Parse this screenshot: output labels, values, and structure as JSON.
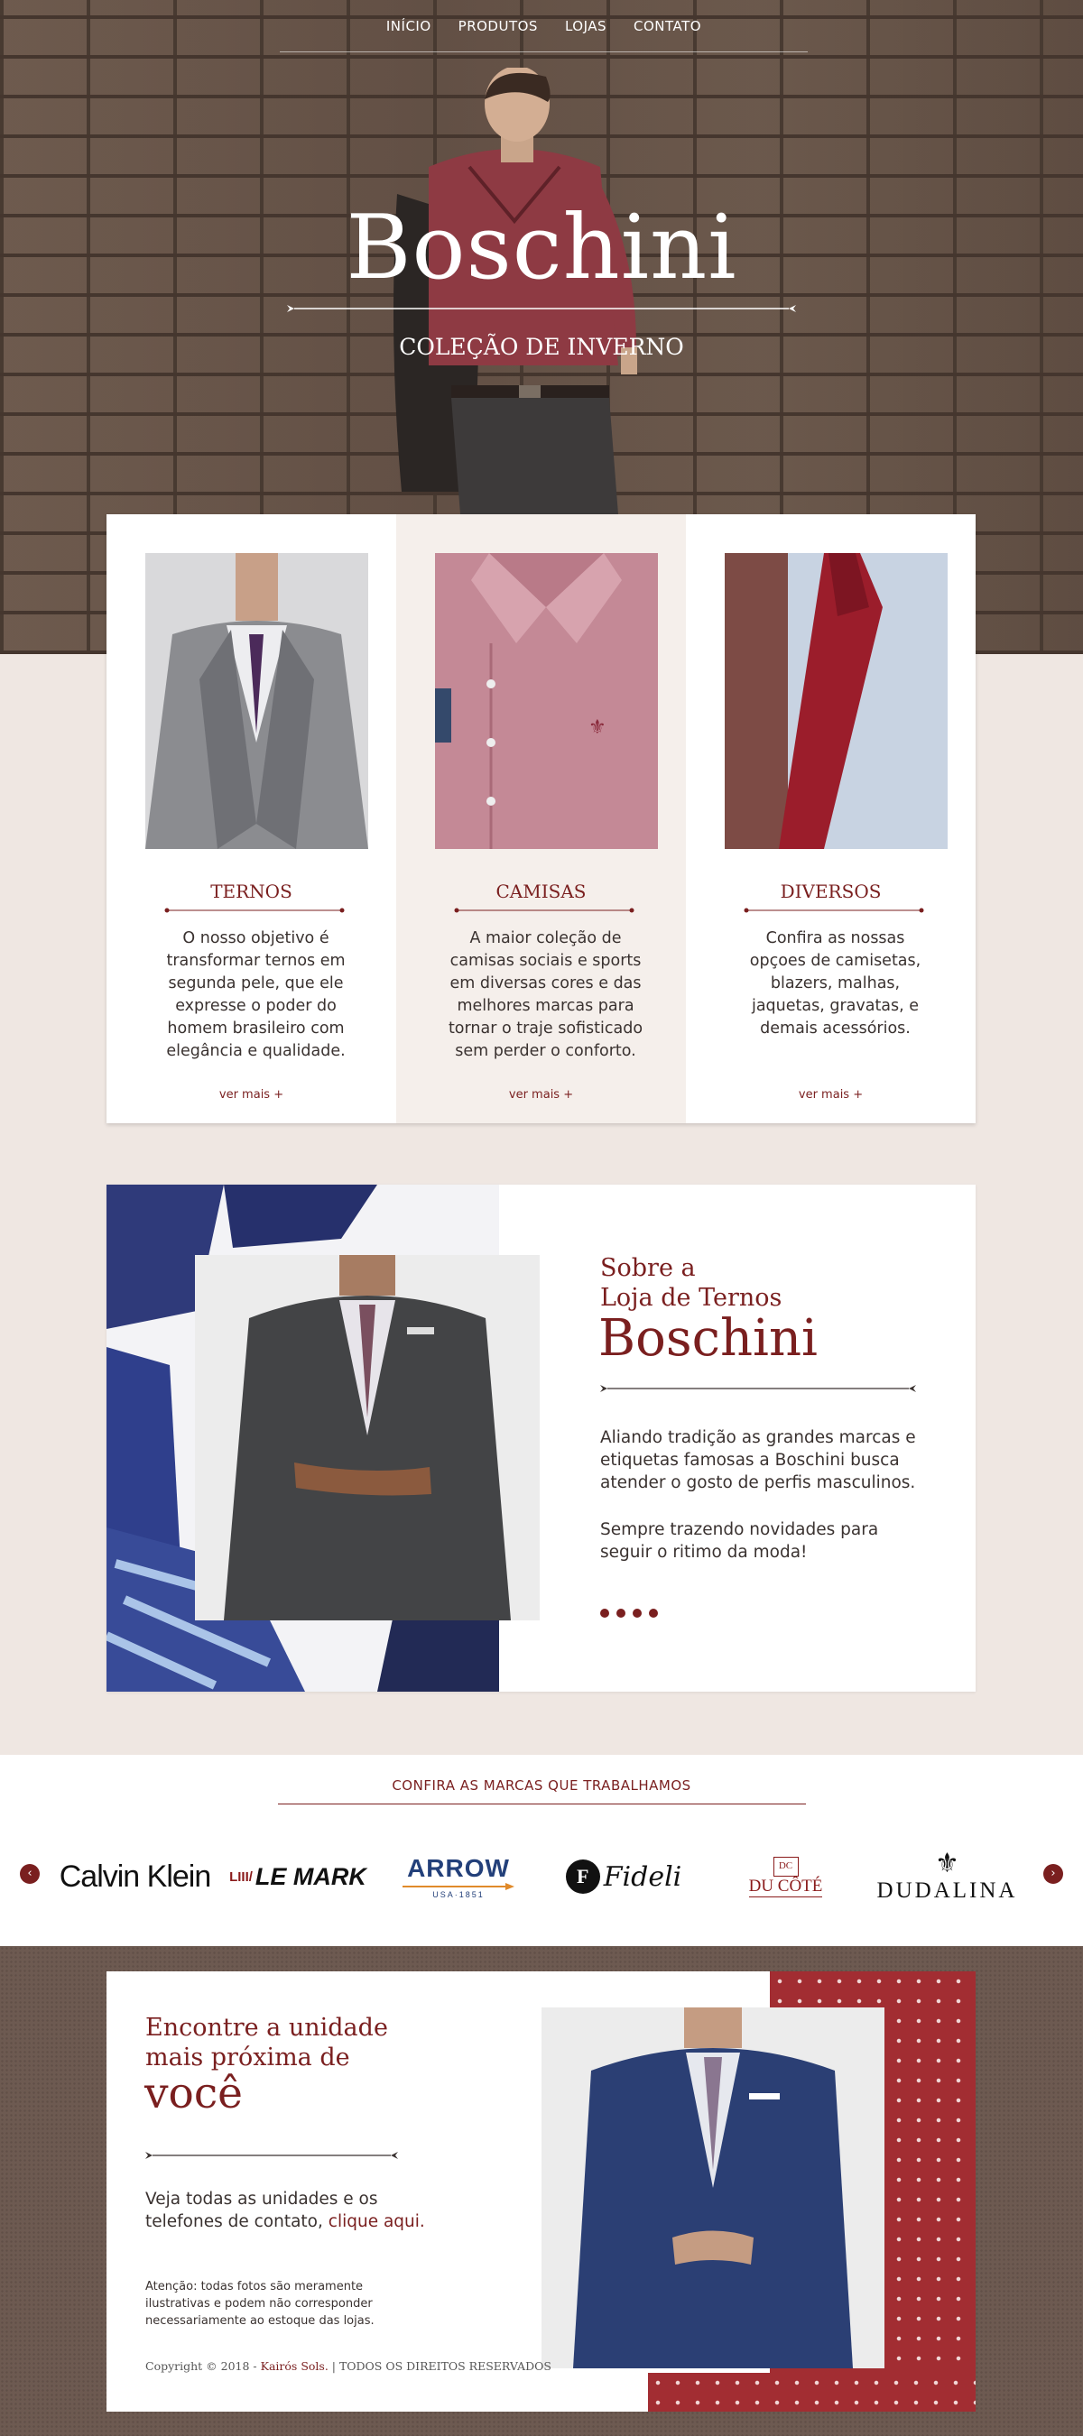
{
  "nav": {
    "items": [
      "INÍCIO",
      "PRODUTOS",
      "LOJAS",
      "CONTATO"
    ]
  },
  "hero": {
    "title": "Boschini",
    "subtitle": "COLEÇÃO DE INVERNO"
  },
  "categories": [
    {
      "title": "TERNOS",
      "text": "O nosso objetivo é transformar ternos em segunda pele, que ele expresse o poder do homem brasileiro com elegância e qualidade.",
      "more": "ver mais +"
    },
    {
      "title": "CAMISAS",
      "text": "A maior coleção de camisas sociais e sports em diversas cores e das melhores marcas para tornar o traje sofisticado sem perder o conforto.",
      "more": "ver mais +"
    },
    {
      "title": "DIVERSOS",
      "text": "Confira as nossas opçoes de camisetas, blazers, malhas, jaquetas, gravatas, e demais acessórios.",
      "more": "ver mais +"
    }
  ],
  "about": {
    "line1": "Sobre a",
    "line2": "Loja de Ternos",
    "brand": "Boschini",
    "p1": "Aliando tradição as grandes marcas e etiquetas famosas a Boschini busca atender o gosto de perfis masculinos.",
    "p2": "Sempre trazendo novidades para seguir o ritimo da moda!"
  },
  "brands": {
    "title": "CONFIRA AS MARCAS QUE TRABALHAMOS",
    "prev_icon": "chevron-left-icon",
    "next_icon": "chevron-right-icon",
    "logos": [
      "Calvin Klein",
      "LE MARK",
      "ARROW",
      "Fideli",
      "DU CÔTÉ",
      "DUDALINA"
    ],
    "arrow_sub": "USA·1851",
    "lemark_prefix": "LIII/"
  },
  "store": {
    "line1": "Encontre a unidade",
    "line2": "mais próxima de",
    "line3": "você",
    "text": "Veja todas as unidades e os telefones de contato,",
    "link": "clique aqui.",
    "note": "Atenção: todas fotos são meramente ilustrativas e podem não corresponder necessariamente ao estoque das lojas."
  },
  "footer": {
    "copyright": "Copyright © 2018 - ",
    "company": "Kairós Sols.",
    "rights": " | TODOS OS DIREITOS RESERVADOS"
  },
  "colors": {
    "accent": "#7a1f1f",
    "hero_bg": "#6e5a4e",
    "page_bg": "#efe7e2"
  }
}
